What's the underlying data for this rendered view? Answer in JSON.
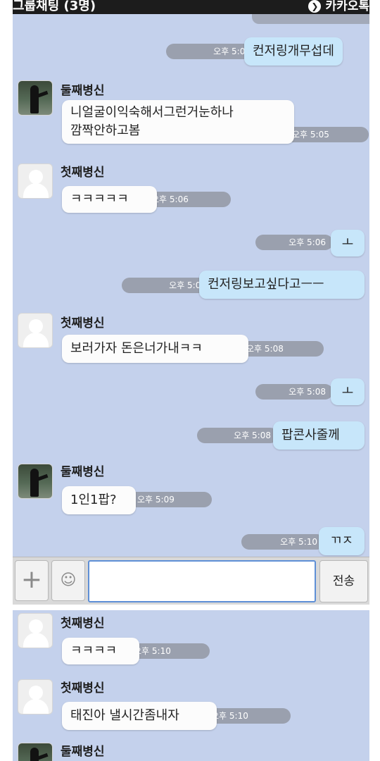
{
  "header": {
    "title": "그룹채팅 (3명)",
    "brand": "카카오톡",
    "brand_icon": "chevron-right-icon"
  },
  "participants": {
    "second": "둘째병신",
    "first": "첫째병신"
  },
  "messages": [
    {
      "from": "me",
      "text": "컨저링개무섭데",
      "time": "오후 5:03"
    },
    {
      "from": "둘째병신",
      "lines": [
        "니얼굴이익숙해서그런거눈하나",
        "깜짝안하고봄"
      ],
      "time": "오후 5:05"
    },
    {
      "from": "첫째병신",
      "text": "ㅋㅋㅋㅋㅋ",
      "time": "오후 5:06"
    },
    {
      "from": "me",
      "text": "ㅗ",
      "time": "오후 5:06"
    },
    {
      "from": "me",
      "text": "컨저링보고싶다고ㅡㅡ",
      "time": "오후 5:06"
    },
    {
      "from": "첫째병신",
      "text": "보러가자 돈은너가내ㅋㅋ",
      "time": "오후 5:08"
    },
    {
      "from": "me",
      "text": "ㅗ",
      "time": "오후 5:08"
    },
    {
      "from": "me",
      "text": "팝콘사줄께",
      "time": "오후 5:08"
    },
    {
      "from": "둘째병신",
      "text": "1인1팝?",
      "time": "오후 5:09"
    },
    {
      "from": "me",
      "text": "ㄲㅈ",
      "time": "오후 5:10"
    },
    {
      "from": "첫째병신",
      "text": "ㅋㅋㅋㅋ",
      "time": "오후 5:10"
    },
    {
      "from": "첫째병신",
      "text": "태진아 낼시간좀내자",
      "time": "오후 5:10"
    },
    {
      "from": "둘째병신",
      "text": "",
      "time": ""
    }
  ],
  "input": {
    "plus_icon": "plus-icon",
    "emoticon_icon": "smile-icon",
    "value": "",
    "send_label": "전송"
  },
  "colors": {
    "chat_bg": "#c4d1ec",
    "my_bubble": "#c7e6fa",
    "their_bubble": "#fcfcfc",
    "time_pill": "#9aa0ae",
    "title_bar": "#1c1c1c",
    "input_focus": "#5e8fd6"
  }
}
